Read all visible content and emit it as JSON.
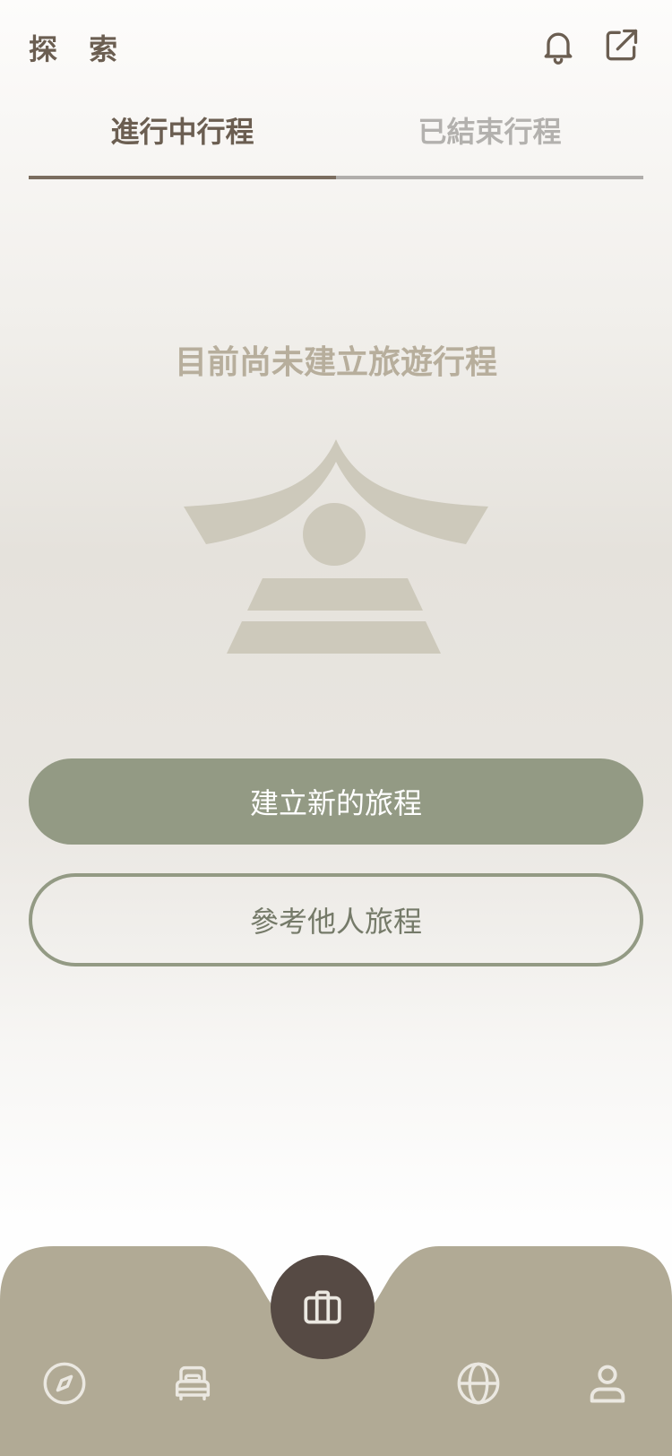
{
  "header": {
    "title": "探 索",
    "bell_icon": "bell-icon",
    "share_icon": "external-link-icon"
  },
  "tabs": [
    {
      "label": "進行中行程",
      "active": true
    },
    {
      "label": "已結束行程",
      "active": false
    }
  ],
  "empty_state": {
    "message": "目前尚未建立旅遊行程",
    "illustration": "temple-roof-illustration"
  },
  "actions": {
    "create_label": "建立新的旅程",
    "browse_label": "參考他人旅程"
  },
  "bottom_nav": {
    "items": [
      {
        "icon": "compass-icon"
      },
      {
        "icon": "bed-icon"
      },
      {
        "icon": "briefcase-icon",
        "active": true
      },
      {
        "icon": "globe-icon"
      },
      {
        "icon": "user-icon"
      }
    ]
  },
  "colors": {
    "accent": "#939a84",
    "brown": "#6b5e51",
    "nav_bg": "#b1aa95",
    "center_btn": "#564a44"
  }
}
